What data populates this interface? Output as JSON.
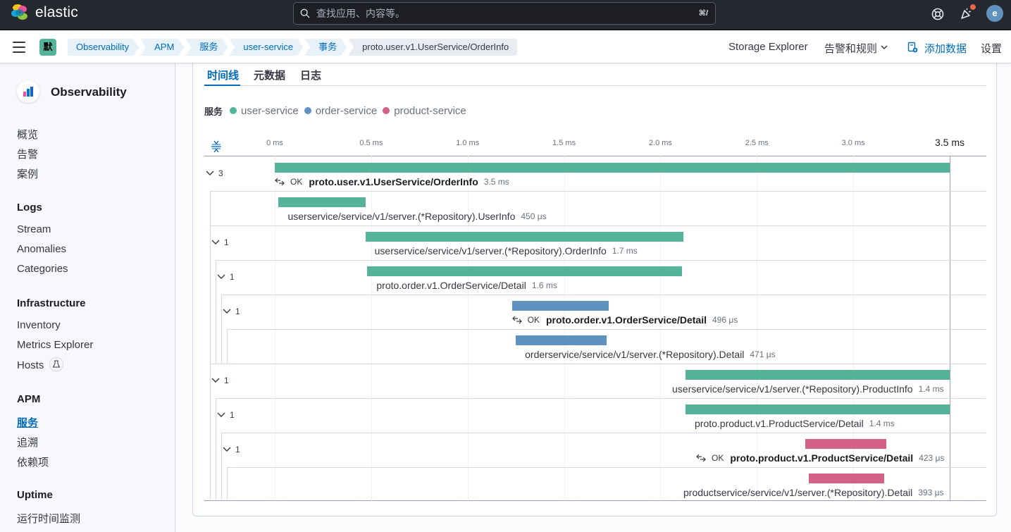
{
  "header": {
    "brand": "elastic",
    "search_placeholder": "查找应用、内容等。",
    "search_shortcut": "⌘/",
    "avatar_letter": "e"
  },
  "subheader": {
    "space_badge": "默",
    "breadcrumbs": [
      "Observability",
      "APM",
      "服务",
      "user-service",
      "事务",
      "proto.user.v1.UserService/OrderInfo"
    ],
    "storage_explorer": "Storage Explorer",
    "alerts_rules": "告警和规则",
    "add_data": "添加数据",
    "settings": "设置"
  },
  "sidebar": {
    "title": "Observability",
    "top_items": [
      "概览",
      "告警",
      "案例"
    ],
    "logs": {
      "title": "Logs",
      "items": [
        "Stream",
        "Anomalies",
        "Categories"
      ]
    },
    "infrastructure": {
      "title": "Infrastructure",
      "items": [
        "Inventory",
        "Metrics Explorer",
        "Hosts"
      ]
    },
    "apm": {
      "title": "APM",
      "items": [
        "服务",
        "追溯",
        "依赖项"
      ]
    },
    "uptime": {
      "title": "Uptime",
      "items": [
        "运行时间监测"
      ]
    }
  },
  "tabs": [
    "时间线",
    "元数据",
    "日志"
  ],
  "legend": {
    "title": "服务",
    "services": [
      {
        "name": "user-service",
        "color": "#54b399"
      },
      {
        "name": "order-service",
        "color": "#6092c0"
      },
      {
        "name": "product-service",
        "color": "#d36086"
      }
    ]
  },
  "timeline": {
    "ticks": [
      "0 ms",
      "0.5 ms",
      "1.0 ms",
      "1.5 ms",
      "2.0 ms",
      "2.5 ms",
      "3.0 ms",
      "3.5 ms"
    ],
    "total_ms": 3.5,
    "spans": [
      {
        "toggle": "3",
        "ok": "OK",
        "name": "proto.user.v1.UserService/OrderInfo",
        "duration": "3.5 ms",
        "service": "user-service",
        "start_ms": 0.0,
        "duration_ms": 3.5
      },
      {
        "toggle": "",
        "ok": "",
        "name": "userservice/service/v1/server.(*Repository).UserInfo",
        "duration": "450 μs",
        "service": "user-service",
        "start_ms": 0.02,
        "duration_ms": 0.45
      },
      {
        "toggle": "1",
        "ok": "",
        "name": "userservice/service/v1/server.(*Repository).OrderInfo",
        "duration": "1.7 ms",
        "service": "user-service",
        "start_ms": 0.47,
        "duration_ms": 1.65
      },
      {
        "toggle": "1",
        "ok": "",
        "name": "proto.order.v1.OrderService/Detail",
        "duration": "1.6 ms",
        "service": "user-service",
        "start_ms": 0.48,
        "duration_ms": 1.63
      },
      {
        "toggle": "1",
        "ok": "OK",
        "name": "proto.order.v1.OrderService/Detail",
        "duration": "496 μs",
        "service": "order-service",
        "start_ms": 1.23,
        "duration_ms": 0.5
      },
      {
        "toggle": "",
        "ok": "",
        "name": "orderservice/service/v1/server.(*Repository).Detail",
        "duration": "471 μs",
        "service": "order-service",
        "start_ms": 1.25,
        "duration_ms": 0.47
      },
      {
        "toggle": "1",
        "ok": "",
        "name": "userservice/service/v1/server.(*Repository).ProductInfo",
        "duration": "1.4 ms",
        "service": "user-service",
        "start_ms": 2.13,
        "duration_ms": 1.37
      },
      {
        "toggle": "1",
        "ok": "",
        "name": "proto.product.v1.ProductService/Detail",
        "duration": "1.4 ms",
        "service": "user-service",
        "start_ms": 2.13,
        "duration_ms": 1.37
      },
      {
        "toggle": "1",
        "ok": "OK",
        "name": "proto.product.v1.ProductService/Detail",
        "duration": "423 μs",
        "service": "product-service",
        "start_ms": 2.75,
        "duration_ms": 0.42
      },
      {
        "toggle": "",
        "ok": "",
        "name": "productservice/service/v1/server.(*Repository).Detail",
        "duration": "393 μs",
        "service": "product-service",
        "start_ms": 2.77,
        "duration_ms": 0.39
      }
    ]
  }
}
